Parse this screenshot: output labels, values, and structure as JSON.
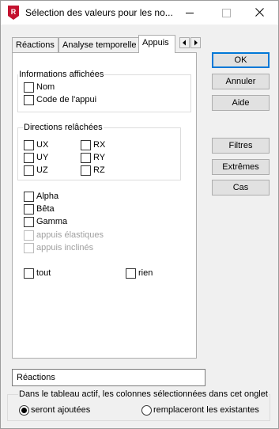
{
  "window": {
    "title": "Sélection des valeurs pour les no...",
    "app_icon_letter": "R"
  },
  "tabs": [
    {
      "label": "Réactions",
      "active": false
    },
    {
      "label": "Analyse temporelle",
      "active": false
    },
    {
      "label": "Appuis",
      "active": true
    }
  ],
  "tab_scroll": {
    "left": "◄",
    "right": "►"
  },
  "info_group": {
    "title": "Informations affichées",
    "items": [
      {
        "label": "Nom",
        "checked": false
      },
      {
        "label": "Code de l'appui",
        "checked": false
      }
    ]
  },
  "directions_group": {
    "title": "Directions relâchées",
    "items": [
      {
        "label": "UX",
        "checked": false
      },
      {
        "label": "RX",
        "checked": false
      },
      {
        "label": "UY",
        "checked": false
      },
      {
        "label": "RY",
        "checked": false
      },
      {
        "label": "UZ",
        "checked": false
      },
      {
        "label": "RZ",
        "checked": false
      }
    ]
  },
  "extra_options": [
    {
      "label": "Alpha",
      "checked": false,
      "enabled": true
    },
    {
      "label": "Bêta",
      "checked": false,
      "enabled": true
    },
    {
      "label": "Gamma",
      "checked": false,
      "enabled": true
    },
    {
      "label": "appuis élastiques",
      "checked": false,
      "enabled": false
    },
    {
      "label": "appuis inclinés",
      "checked": false,
      "enabled": false
    }
  ],
  "select_all": {
    "tout": "tout",
    "rien": "rien"
  },
  "buttons": {
    "ok": "OK",
    "cancel": "Annuler",
    "help": "Aide",
    "filters": "Filtres",
    "extremes": "Extrêmes",
    "cases": "Cas"
  },
  "result_field": {
    "value": "Réactions"
  },
  "columns_group": {
    "title": "Dans le tableau actif, les colonnes sélectionnées dans cet onglet",
    "options": [
      {
        "label": "seront ajoutées",
        "selected": true
      },
      {
        "label": "remplaceront les existantes",
        "selected": false
      }
    ]
  },
  "colors": {
    "accent": "#0078d7",
    "app_icon": "#c4122f"
  }
}
